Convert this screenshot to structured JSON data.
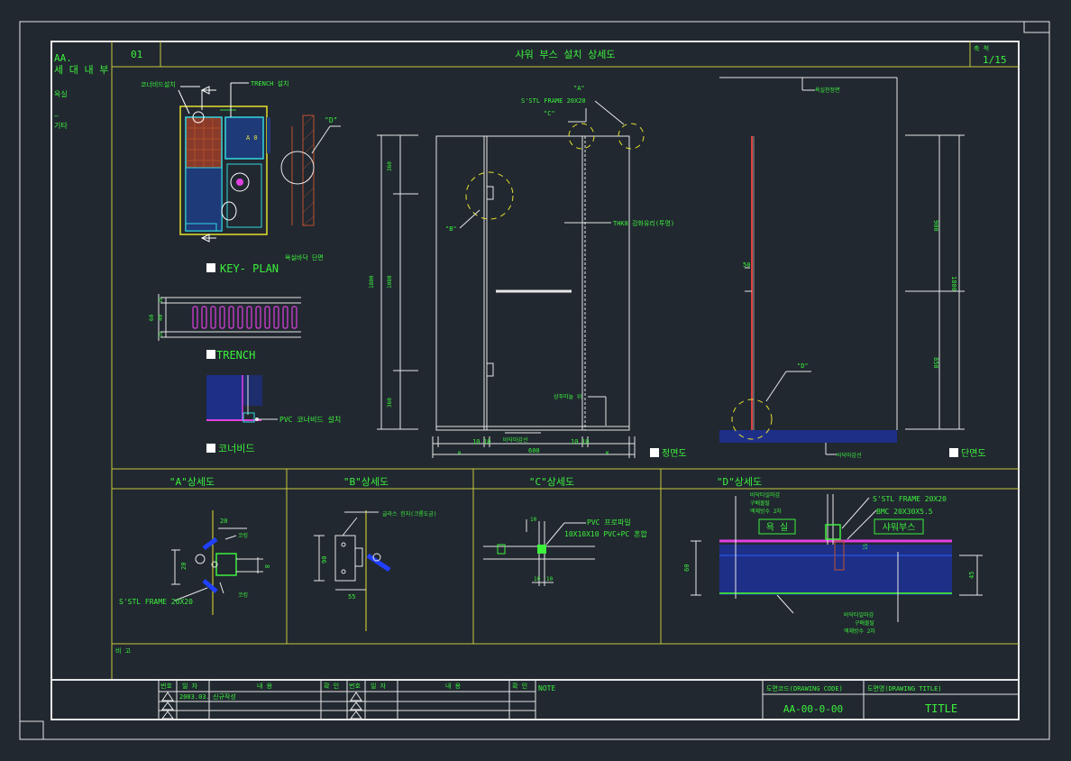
{
  "sheet": {
    "left_title": [
      "AA.",
      "세 대 내 부"
    ],
    "left_room": "욕실",
    "left_dash": "—",
    "left_misc": "기타",
    "sheet_no": "01",
    "title": "샤워 부스 설치 상세도",
    "scale_label": "축 척",
    "scale_value": "1/15",
    "remarks_label": "비 고"
  },
  "key_plan": {
    "label": "KEY- PLAN",
    "corner_bead_install": "코너비드설치",
    "trench_install": "TRENCH 설치",
    "area_label": "A 0",
    "bath_floor_section": "욕실바닥 단면",
    "callout_d": "\"D\""
  },
  "trench": {
    "label": "TRENCH",
    "dims": [
      "60",
      "40",
      "10",
      "10"
    ]
  },
  "corner_bead": {
    "label": "코너비드",
    "pvc_note": "PVC 코너비드 설치"
  },
  "front_view": {
    "label": "정면도",
    "callout_a": "\"A\"",
    "frame_note": "S'STL FRAME 20X20",
    "callout_c": "\"C\"",
    "callout_b": "\"B\"",
    "glass_note": "THK8 강화유리(투명)",
    "shampoo_note": "샴푸미놀 위",
    "floor_finish": "바닥마감선",
    "dims_left": [
      "360",
      "1800",
      "1080",
      "360"
    ],
    "dims_bottom": [
      "10",
      "10",
      "10",
      "10",
      "600",
      "W",
      "W"
    ]
  },
  "section_view": {
    "label": "단면도",
    "ceiling_note": "욕실천정면",
    "callout_d": "\"D\"",
    "floor_finish": "바닥마감선",
    "dims_right": [
      "900",
      "1800",
      "850"
    ],
    "dim_50": "50"
  },
  "details": {
    "a": {
      "title": "\"A\"상세도",
      "frame_note": "S'STL FRAME 20X20",
      "caulk1": "코킹",
      "caulk2": "코킹",
      "dims": [
        "20",
        "20",
        "8"
      ]
    },
    "b": {
      "title": "\"B\"상세도",
      "hinge_note": "글라스 힌지(크롬도금)",
      "dims": [
        "90",
        "55"
      ]
    },
    "c": {
      "title": "\"C\"상세도",
      "pvc_note1": "PVC 프로파일",
      "pvc_note2": "10X10X10 PVC+PC 혼합",
      "dims": [
        "10",
        "10",
        "10"
      ]
    },
    "d": {
      "title": "\"D\"상세도",
      "layers_top": [
        "바닥타일마감",
        "구배몰탈",
        "액체방수 2차"
      ],
      "frame_note": "S'STL FRAME 20X20",
      "bmc_note": "BMC 20X30X5.5",
      "room_left": "욕 실",
      "room_right": "샤워부스",
      "layers_bottom": [
        "바닥타일마감",
        "구배몰탈",
        "액체방수 2차"
      ],
      "dims": [
        "60",
        "45",
        "15"
      ]
    }
  },
  "title_block": {
    "rev_headers": [
      "번호",
      "일 자",
      "내 용",
      "확 인"
    ],
    "rev_headers2": [
      "번호",
      "일 자",
      "내 용",
      "확 인"
    ],
    "rev_rows": [
      {
        "date": "2003.03.",
        "content": "신규작성"
      }
    ],
    "note_label": "NOTE",
    "drawing_code_label": "도면코드(DRAWING CODE)",
    "drawing_code": "AA-00-0-00",
    "drawing_title_label": "도면명(DRAWING TITLE)",
    "drawing_title": "TITLE"
  },
  "colors": {
    "background": "#212830",
    "frame": "#e6e6e6",
    "grid": "#c8c83c",
    "text": "#3cf03c"
  }
}
